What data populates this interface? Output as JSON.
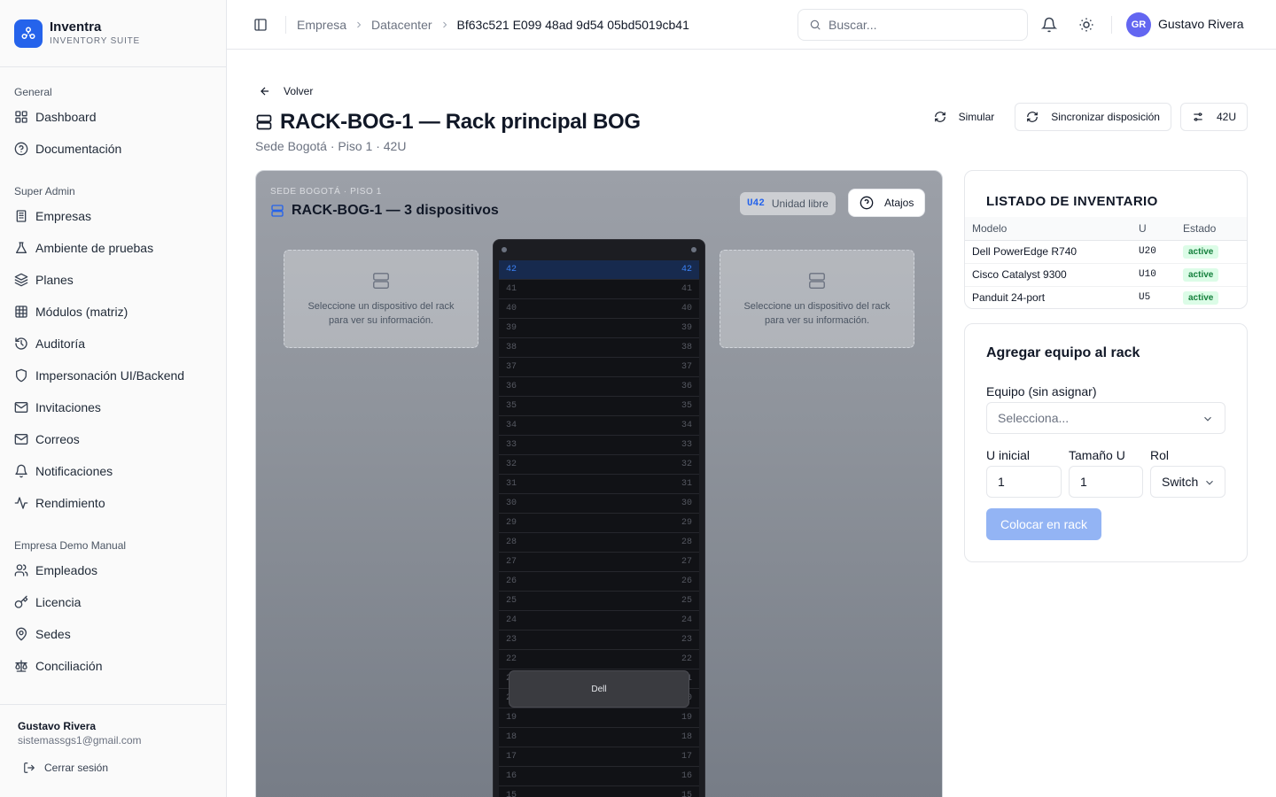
{
  "brand": {
    "name": "Inventra",
    "subtitle": "INVENTORY SUITE"
  },
  "sidebar": {
    "sections": [
      {
        "title": "General",
        "items": [
          {
            "label": "Dashboard",
            "icon": "layout-grid-icon"
          },
          {
            "label": "Documentación",
            "icon": "help-circle-icon"
          }
        ]
      },
      {
        "title": "Super Admin",
        "items": [
          {
            "label": "Empresas",
            "icon": "building-icon"
          },
          {
            "label": "Ambiente de pruebas",
            "icon": "flask-icon"
          },
          {
            "label": "Planes",
            "icon": "layers-icon"
          },
          {
            "label": "Módulos (matriz)",
            "icon": "table-icon"
          },
          {
            "label": "Auditoría",
            "icon": "history-icon"
          },
          {
            "label": "Impersonación UI/Backend",
            "icon": "shield-icon"
          },
          {
            "label": "Invitaciones",
            "icon": "mail-icon"
          },
          {
            "label": "Correos",
            "icon": "mail-icon"
          },
          {
            "label": "Notificaciones",
            "icon": "bell-icon"
          },
          {
            "label": "Rendimiento",
            "icon": "activity-icon"
          }
        ]
      },
      {
        "title": "Empresa Demo Manual",
        "items": [
          {
            "label": "Empleados",
            "icon": "users-icon"
          },
          {
            "label": "Licencia",
            "icon": "key-icon"
          },
          {
            "label": "Sedes",
            "icon": "map-pin-icon"
          },
          {
            "label": "Conciliación",
            "icon": "scale-icon"
          }
        ]
      }
    ],
    "footer": {
      "user_name": "Gustavo Rivera",
      "user_email": "sistemassgs1@gmail.com",
      "logout_label": "Cerrar sesión"
    }
  },
  "topbar": {
    "breadcrumbs": [
      "Empresa",
      "Datacenter",
      "Bf63c521 E099 48ad 9d54 05bd5019cb41"
    ],
    "search_placeholder": "Buscar...",
    "avatar_initials": "GR",
    "user_name": "Gustavo Rivera"
  },
  "page": {
    "back_label": "Volver",
    "title": "RACK-BOG-1 — Rack principal BOG",
    "subtitle": "Sede Bogotá · Piso 1 · 42U",
    "actions": {
      "simulate": "Simular",
      "sync": "Sincronizar disposición",
      "units": "42U"
    }
  },
  "rack_panel": {
    "eyebrow": "SEDE BOGOTÁ · PISO 1",
    "title": "RACK-BOG-1 — 3 dispositivos",
    "free_unit_code": "U42",
    "free_unit_label": "Unidad libre",
    "shortcuts_label": "Atajos",
    "info_placeholder": "Seleccione un dispositivo del rack para ver su información.",
    "units_visible": [
      42,
      41,
      40,
      39,
      38,
      37,
      36,
      35,
      34,
      33,
      32,
      31,
      30,
      29,
      28,
      27,
      26,
      25,
      24,
      23,
      22,
      21,
      20,
      19,
      18,
      17,
      16,
      15
    ],
    "selected_unit": 42,
    "device_label": "Dell"
  },
  "inventory": {
    "title": "LISTADO DE INVENTARIO",
    "columns": [
      "Modelo",
      "U",
      "Estado"
    ],
    "rows": [
      {
        "model": "Dell PowerEdge R740",
        "u": "U20",
        "status": "active"
      },
      {
        "model": "Cisco Catalyst 9300",
        "u": "U10",
        "status": "active"
      },
      {
        "model": "Panduit 24-port",
        "u": "U5",
        "status": "active"
      }
    ]
  },
  "add_form": {
    "title": "Agregar equipo al rack",
    "equipment_label": "Equipo (sin asignar)",
    "equipment_placeholder": "Selecciona...",
    "start_u_label": "U inicial",
    "start_u_value": "1",
    "size_u_label": "Tamaño U",
    "size_u_value": "1",
    "role_label": "Rol",
    "role_value": "Switch",
    "submit_label": "Colocar en rack"
  },
  "colors": {
    "accent": "#2563eb",
    "status_active_bg": "#dcfce7",
    "status_active_fg": "#15803d",
    "rack_selected": "#172a4e"
  }
}
